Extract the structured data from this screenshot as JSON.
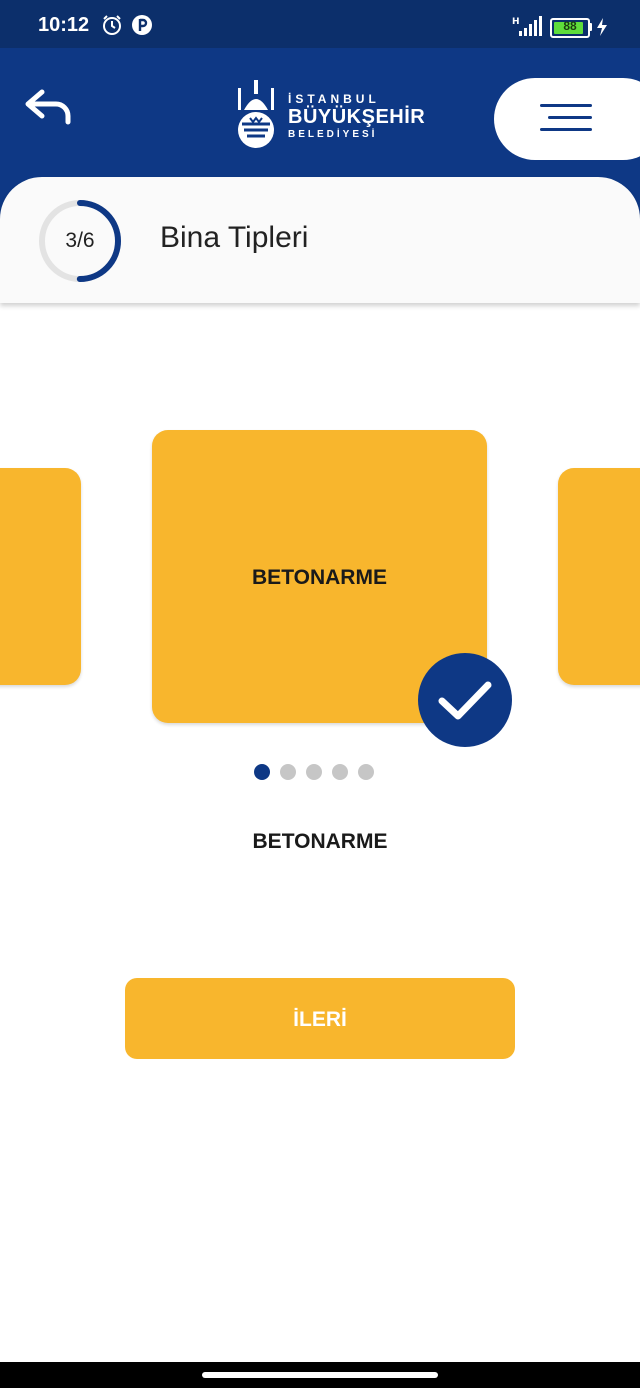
{
  "status_bar": {
    "time": "10:12",
    "battery": "88",
    "icons": [
      "alarm-icon",
      "app-notification-icon",
      "signal-icon",
      "battery-icon",
      "charging-icon"
    ]
  },
  "header": {
    "logo": {
      "line1": "İSTANBUL",
      "line2": "BÜYÜKŞEHİR",
      "line3": "BELEDİYESİ"
    },
    "icons": [
      "back-arrow-icon",
      "menu-icon"
    ]
  },
  "step": {
    "progress_label": "3/6",
    "current": 3,
    "total": 6,
    "title": "Bina Tipleri"
  },
  "carousel": {
    "items": [
      {
        "label": "BETONARME",
        "selected": true
      }
    ],
    "page_count": 5,
    "active_index": 0
  },
  "selected_label": "BETONARME",
  "next_button": {
    "label": "İLERİ"
  },
  "colors": {
    "primary": "#0e3885",
    "accent": "#f8b62d",
    "status_bar": "#0c2f6b"
  }
}
